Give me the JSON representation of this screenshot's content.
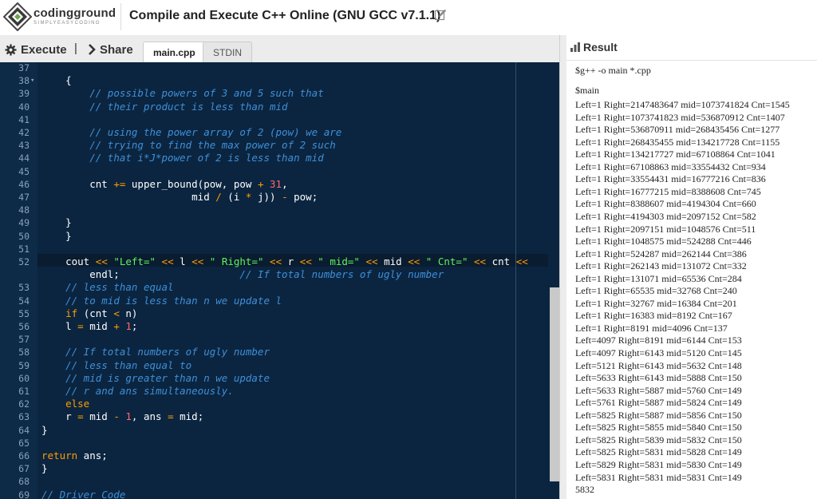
{
  "brand": {
    "name": "codingground",
    "tagline": "SIMPLYEASYCODING"
  },
  "title": "Compile and Execute C++ Online (GNU GCC v7.1.1)",
  "toolbar": {
    "execute": "Execute",
    "separator": "|",
    "share": "Share"
  },
  "tabs": [
    {
      "label": "main.cpp",
      "active": true
    },
    {
      "label": "STDIN",
      "active": false
    }
  ],
  "result": {
    "title": "Result",
    "command": "$g++ -o main *.cpp",
    "run": "$main",
    "output": [
      "Left=1 Right=2147483647 mid=1073741824 Cnt=1545",
      "Left=1 Right=1073741823 mid=536870912 Cnt=1407",
      "Left=1 Right=536870911 mid=268435456 Cnt=1277",
      "Left=1 Right=268435455 mid=134217728 Cnt=1155",
      "Left=1 Right=134217727 mid=67108864 Cnt=1041",
      "Left=1 Right=67108863 mid=33554432 Cnt=934",
      "Left=1 Right=33554431 mid=16777216 Cnt=836",
      "Left=1 Right=16777215 mid=8388608 Cnt=745",
      "Left=1 Right=8388607 mid=4194304 Cnt=660",
      "Left=1 Right=4194303 mid=2097152 Cnt=582",
      "Left=1 Right=2097151 mid=1048576 Cnt=511",
      "Left=1 Right=1048575 mid=524288 Cnt=446",
      "Left=1 Right=524287 mid=262144 Cnt=386",
      "Left=1 Right=262143 mid=131072 Cnt=332",
      "Left=1 Right=131071 mid=65536 Cnt=284",
      "Left=1 Right=65535 mid=32768 Cnt=240",
      "Left=1 Right=32767 mid=16384 Cnt=201",
      "Left=1 Right=16383 mid=8192 Cnt=167",
      "Left=1 Right=8191 mid=4096 Cnt=137",
      "Left=4097 Right=8191 mid=6144 Cnt=153",
      "Left=4097 Right=6143 mid=5120 Cnt=145",
      "Left=5121 Right=6143 mid=5632 Cnt=148",
      "Left=5633 Right=6143 mid=5888 Cnt=150",
      "Left=5633 Right=5887 mid=5760 Cnt=149",
      "Left=5761 Right=5887 mid=5824 Cnt=149",
      "Left=5825 Right=5887 mid=5856 Cnt=150",
      "Left=5825 Right=5855 mid=5840 Cnt=150",
      "Left=5825 Right=5839 mid=5832 Cnt=150",
      "Left=5825 Right=5831 mid=5828 Cnt=149",
      "Left=5829 Right=5831 mid=5830 Cnt=149",
      "Left=5831 Right=5831 mid=5831 Cnt=149",
      "5832"
    ]
  },
  "editor": {
    "lines": [
      {
        "n": "37",
        "segs": []
      },
      {
        "n": "38",
        "fold": true,
        "segs": [
          [
            "p",
            "    {"
          ]
        ]
      },
      {
        "n": "39",
        "segs": [
          [
            "p",
            "        "
          ],
          [
            "c",
            "// possible powers of 3 and 5 such that"
          ]
        ]
      },
      {
        "n": "40",
        "segs": [
          [
            "p",
            "        "
          ],
          [
            "c",
            "// their product is less than mid"
          ]
        ]
      },
      {
        "n": "41",
        "segs": []
      },
      {
        "n": "42",
        "segs": [
          [
            "p",
            "        "
          ],
          [
            "c",
            "// using the power array of 2 (pow) we are"
          ]
        ]
      },
      {
        "n": "43",
        "segs": [
          [
            "p",
            "        "
          ],
          [
            "c",
            "// trying to find the max power of 2 such"
          ]
        ]
      },
      {
        "n": "44",
        "segs": [
          [
            "p",
            "        "
          ],
          [
            "c",
            "// that i*J*power of 2 is less than mid"
          ]
        ]
      },
      {
        "n": "45",
        "segs": []
      },
      {
        "n": "46",
        "segs": [
          [
            "p",
            "        cnt "
          ],
          [
            "o",
            "+="
          ],
          [
            "p",
            " upper_bound(pow, pow "
          ],
          [
            "o",
            "+"
          ],
          [
            "p",
            " "
          ],
          [
            "n",
            "31"
          ],
          [
            "p",
            ","
          ]
        ]
      },
      {
        "n": "47",
        "segs": [
          [
            "p",
            "                         mid "
          ],
          [
            "o",
            "/"
          ],
          [
            "p",
            " (i "
          ],
          [
            "o",
            "*"
          ],
          [
            "p",
            " j)) "
          ],
          [
            "o",
            "-"
          ],
          [
            "p",
            " pow;"
          ]
        ]
      },
      {
        "n": "48",
        "segs": []
      },
      {
        "n": "49",
        "segs": [
          [
            "p",
            "    }"
          ]
        ]
      },
      {
        "n": "50",
        "segs": [
          [
            "p",
            "    }"
          ]
        ]
      },
      {
        "n": "51",
        "segs": []
      },
      {
        "n": "52",
        "segs": [
          [
            "p",
            "    cout "
          ],
          [
            "o",
            "<<"
          ],
          [
            "p",
            " "
          ],
          [
            "s",
            "\"Left=\""
          ],
          [
            "p",
            " "
          ],
          [
            "o",
            "<<"
          ],
          [
            "p",
            " l "
          ],
          [
            "o",
            "<<"
          ],
          [
            "p",
            " "
          ],
          [
            "s",
            "\" Right=\""
          ],
          [
            "p",
            " "
          ],
          [
            "o",
            "<<"
          ],
          [
            "p",
            " r "
          ],
          [
            "o",
            "<<"
          ],
          [
            "p",
            " "
          ],
          [
            "s",
            "\" mid=\""
          ],
          [
            "p",
            " "
          ],
          [
            "o",
            "<<"
          ],
          [
            "p",
            " mid "
          ],
          [
            "o",
            "<<"
          ],
          [
            "p",
            " "
          ],
          [
            "s",
            "\" Cnt=\""
          ],
          [
            "p",
            " "
          ],
          [
            "o",
            "<<"
          ],
          [
            "p",
            " cnt "
          ],
          [
            "o",
            "<<"
          ]
        ]
      },
      {
        "n": "",
        "segs": [
          [
            "p",
            "        endl;                    "
          ],
          [
            "c",
            "// If total numbers of ugly number"
          ]
        ]
      },
      {
        "n": "53",
        "segs": [
          [
            "p",
            "    "
          ],
          [
            "c",
            "// less than equal"
          ]
        ]
      },
      {
        "n": "54",
        "segs": [
          [
            "p",
            "    "
          ],
          [
            "c",
            "// to mid is less than n we update l"
          ]
        ]
      },
      {
        "n": "55",
        "segs": [
          [
            "p",
            "    "
          ],
          [
            "k",
            "if"
          ],
          [
            "p",
            " (cnt "
          ],
          [
            "o",
            "<"
          ],
          [
            "p",
            " n)"
          ]
        ]
      },
      {
        "n": "56",
        "segs": [
          [
            "p",
            "    l "
          ],
          [
            "o",
            "="
          ],
          [
            "p",
            " mid "
          ],
          [
            "o",
            "+"
          ],
          [
            "p",
            " "
          ],
          [
            "n",
            "1"
          ],
          [
            "p",
            ";"
          ]
        ]
      },
      {
        "n": "57",
        "segs": []
      },
      {
        "n": "58",
        "segs": [
          [
            "p",
            "    "
          ],
          [
            "c",
            "// If total numbers of ugly number"
          ]
        ]
      },
      {
        "n": "59",
        "segs": [
          [
            "p",
            "    "
          ],
          [
            "c",
            "// less than equal to"
          ]
        ]
      },
      {
        "n": "60",
        "segs": [
          [
            "p",
            "    "
          ],
          [
            "c",
            "// mid is greater than n we update"
          ]
        ]
      },
      {
        "n": "61",
        "segs": [
          [
            "p",
            "    "
          ],
          [
            "c",
            "// r and ans simultaneously."
          ]
        ]
      },
      {
        "n": "62",
        "segs": [
          [
            "p",
            "    "
          ],
          [
            "k",
            "else"
          ]
        ]
      },
      {
        "n": "63",
        "segs": [
          [
            "p",
            "    r "
          ],
          [
            "o",
            "="
          ],
          [
            "p",
            " mid "
          ],
          [
            "o",
            "-"
          ],
          [
            "p",
            " "
          ],
          [
            "n",
            "1"
          ],
          [
            "p",
            ", ans "
          ],
          [
            "o",
            "="
          ],
          [
            "p",
            " mid;"
          ]
        ]
      },
      {
        "n": "64",
        "segs": [
          [
            "p",
            "}"
          ]
        ]
      },
      {
        "n": "65",
        "segs": []
      },
      {
        "n": "66",
        "segs": [
          [
            "k",
            "return"
          ],
          [
            "p",
            " ans;"
          ]
        ]
      },
      {
        "n": "67",
        "segs": [
          [
            "p",
            "}"
          ]
        ]
      },
      {
        "n": "68",
        "segs": []
      },
      {
        "n": "69",
        "segs": [
          [
            "c",
            "// Driver Code"
          ]
        ]
      }
    ]
  }
}
